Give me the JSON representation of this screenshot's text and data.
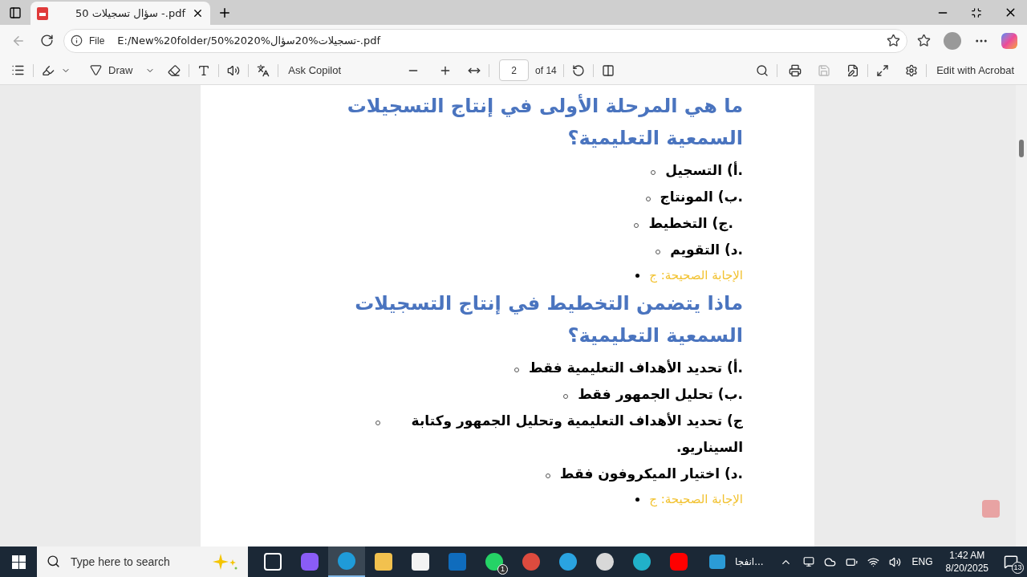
{
  "tab": {
    "title": "50 سؤال تسجيلات -.pdf",
    "selected": true
  },
  "address": {
    "scheme": "File",
    "url": "E:/New%20folder/50%2020%تسجيلات%20سؤال-.pdf"
  },
  "pdf_toolbar": {
    "draw": "Draw",
    "ask": "Ask Copilot",
    "page": "2",
    "total": "of 14",
    "edit": "Edit with Acrobat"
  },
  "questions": [
    {
      "question": "ما هي المرحلة الأولى في إنتاج التسجيلات السمعية التعليمية؟",
      "options": [
        ".أ) التسجيل",
        ".ب) المونتاج",
        ".ج) التخطيط",
        ".د) التقويم"
      ],
      "answer": "الإجابة الصحيحة: ج"
    },
    {
      "question": "ماذا يتضمن التخطيط في إنتاج التسجيلات السمعية التعليمية؟",
      "options": [
        ".أ) تحديد الأهداف التعليمية فقط",
        ".ب) تحليل الجمهور فقط",
        "ج) تحديد الأهداف التعليمية وتحليل الجمهور وكتابة السيناريو.",
        ".د) اختيار الميكروفون فقط"
      ],
      "answer": "الإجابة الصحيحة: ج"
    }
  ],
  "taskbar": {
    "search": {
      "placeholder": "Type here to search"
    },
    "whatsapp_badge": "1",
    "app_label": "انفجا...",
    "language": "ENG",
    "time": "1:42 AM",
    "date": "8/20/2025",
    "notifications": "13"
  }
}
